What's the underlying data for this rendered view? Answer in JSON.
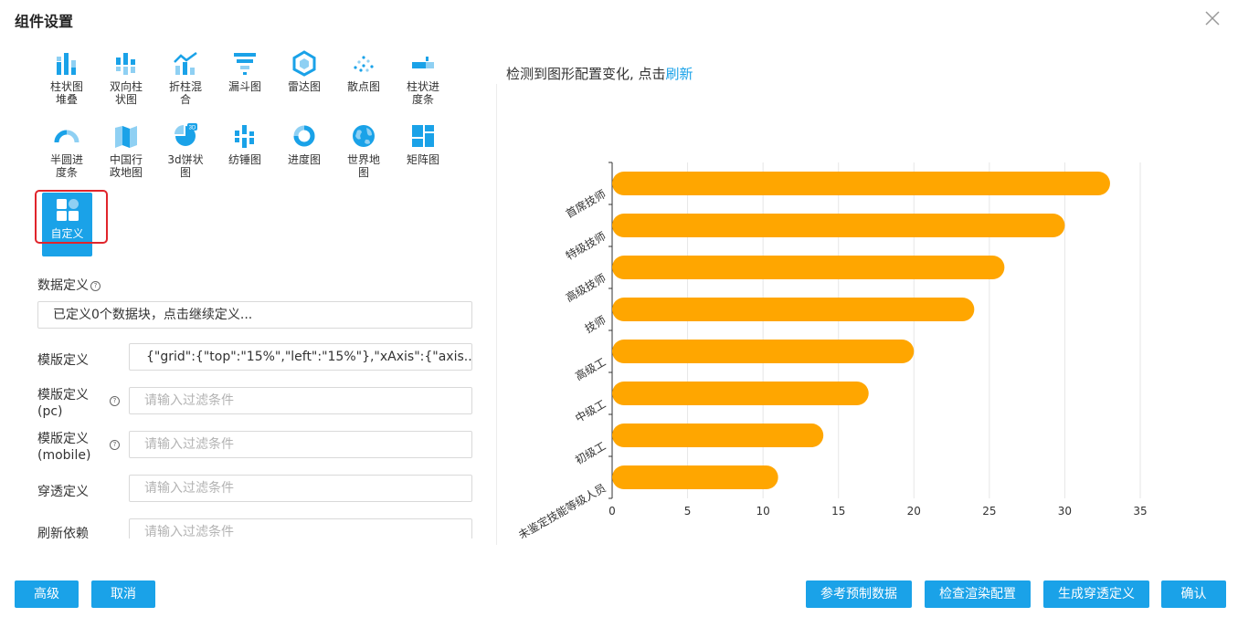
{
  "dialog": {
    "title": "组件设置"
  },
  "chart_types": [
    {
      "label": "柱状图\n堆叠",
      "icon": "stacked-bar-icon"
    },
    {
      "label": "双向柱\n状图",
      "icon": "bidirectional-bar-icon"
    },
    {
      "label": "折柱混\n合",
      "icon": "line-bar-mix-icon"
    },
    {
      "label": "漏斗图",
      "icon": "funnel-icon"
    },
    {
      "label": "雷达图",
      "icon": "radar-icon"
    },
    {
      "label": "散点图",
      "icon": "scatter-icon"
    },
    {
      "label": "柱状进\n度条",
      "icon": "bar-progress-icon"
    },
    {
      "label": "半圆进\n度条",
      "icon": "semicircle-progress-icon"
    },
    {
      "label": "中国行\n政地图",
      "icon": "china-map-icon"
    },
    {
      "label": "3d饼状\n图",
      "icon": "pie-3d-icon"
    },
    {
      "label": "纺锤图",
      "icon": "spindle-icon"
    },
    {
      "label": "进度图",
      "icon": "progress-ring-icon"
    },
    {
      "label": "世界地\n图",
      "icon": "globe-icon"
    },
    {
      "label": "矩阵图",
      "icon": "matrix-icon"
    },
    {
      "label": "自定义",
      "icon": "custom-grid-icon",
      "selected": true
    }
  ],
  "form": {
    "data_def_label": "数据定义",
    "data_def_value": "已定义0个数据块，点击继续定义...",
    "template_label": "模版定义",
    "template_value": "{\"grid\":{\"top\":\"15%\",\"left\":\"15%\"},\"xAxis\":{\"axis...",
    "template_pc_label_1": "模版定义",
    "template_pc_label_2": "(pc)",
    "template_pc_placeholder": "请输入过滤条件",
    "template_mobile_label_1": "模版定义",
    "template_mobile_label_2": "(mobile)",
    "template_mobile_placeholder": "请输入过滤条件",
    "drill_label": "穿透定义",
    "drill_placeholder": "请输入过滤条件",
    "refresh_dep_label": "刷新依赖",
    "refresh_dep_placeholder": "请输入过滤条件"
  },
  "preview": {
    "notice_text": "检测到图形配置变化, 点击",
    "notice_link": "刷新"
  },
  "chart_data": {
    "type": "bar",
    "orientation": "horizontal",
    "categories": [
      "首席技师",
      "特级技师",
      "高级技师",
      "技师",
      "高级工",
      "中级工",
      "初级工",
      "未鉴定技能等级人员"
    ],
    "values": [
      33,
      30,
      26,
      24,
      20,
      17,
      14,
      11
    ],
    "xlim": [
      0,
      35
    ],
    "xticks": [
      "0",
      "5",
      "10",
      "15",
      "20",
      "25",
      "30",
      "35"
    ],
    "bar_color": "#ffa600",
    "grid": true
  },
  "footer": {
    "advanced": "高级",
    "cancel": "取消",
    "reference_data": "参考预制数据",
    "check_render": "检查渲染配置",
    "generate_drill": "生成穿透定义",
    "confirm": "确认"
  },
  "colors": {
    "accent": "#1aa2e8",
    "bar": "#ffa600",
    "highlight": "#e0242b"
  }
}
